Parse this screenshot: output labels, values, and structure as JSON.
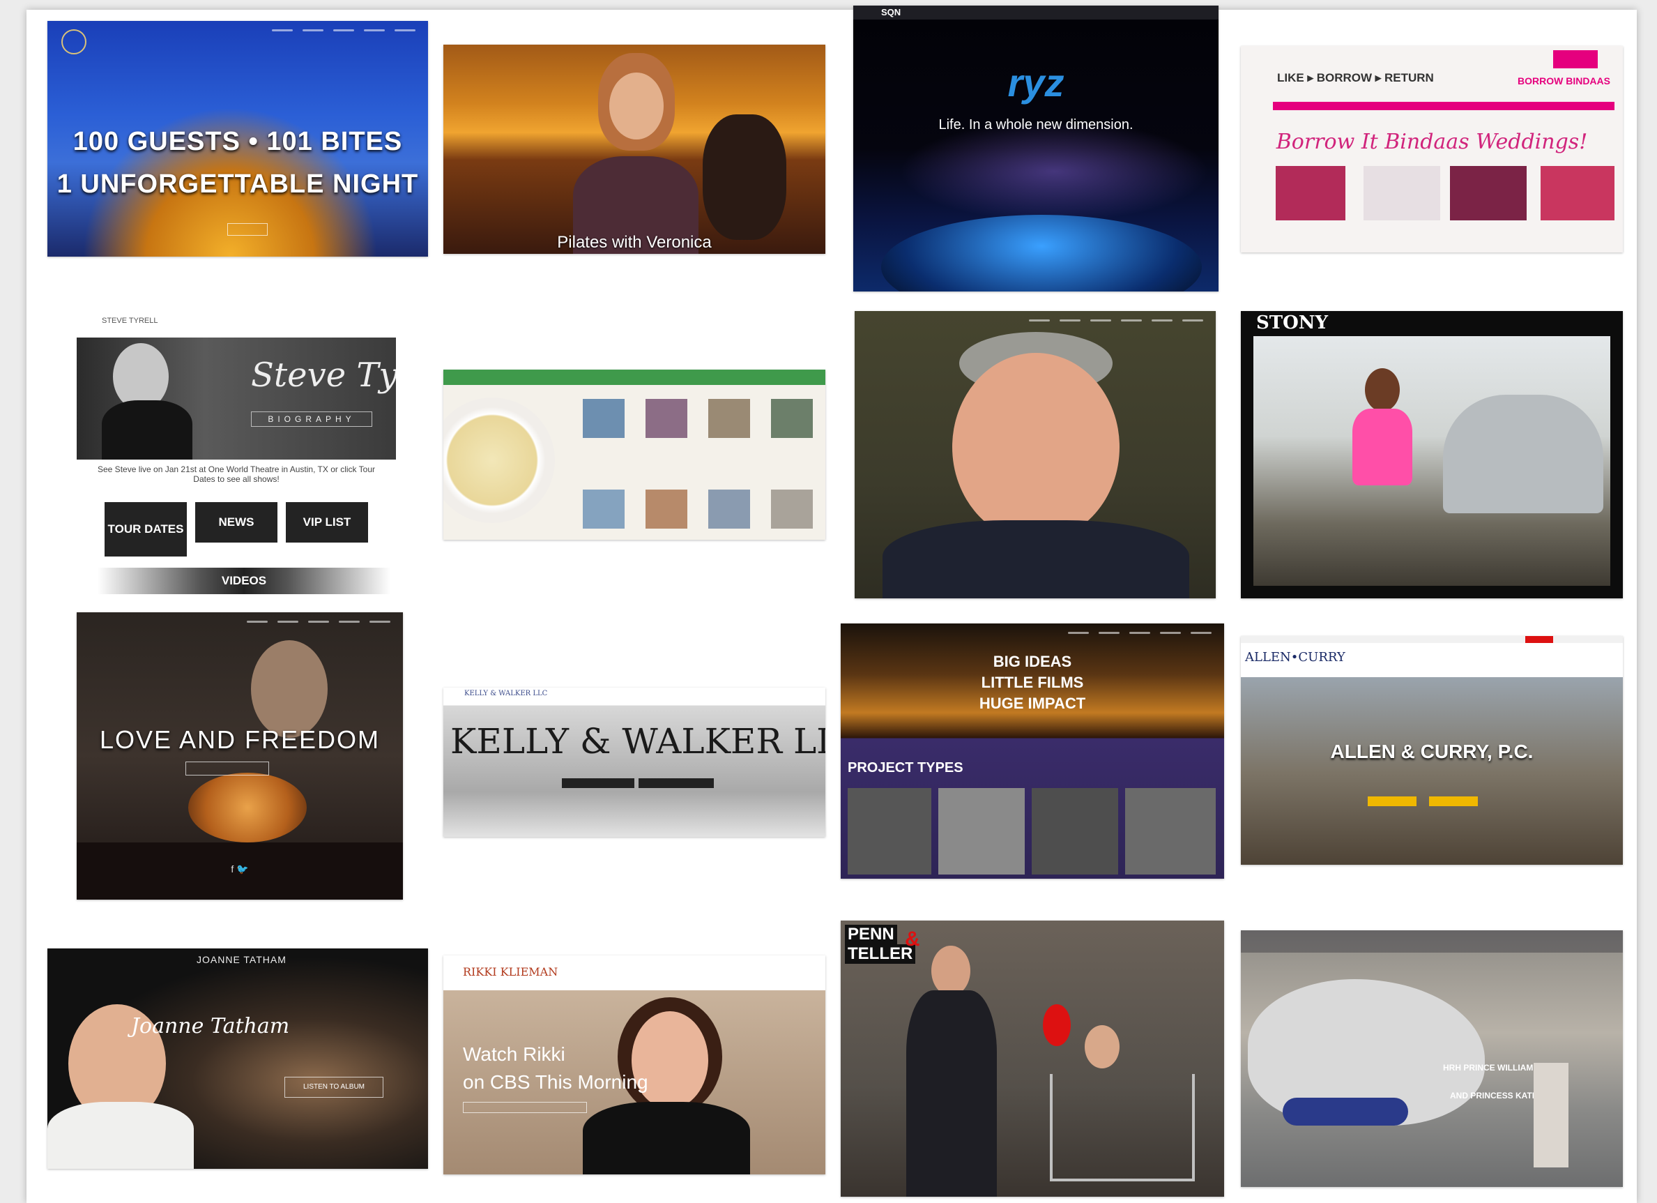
{
  "tiles": {
    "eiffel": {
      "line1": "100 GUESTS • 101 BITES",
      "line2": "1 UNFORGETTABLE NIGHT"
    },
    "pilates": {
      "caption": "Pilates with Veronica"
    },
    "ryz": {
      "logo": "ryz",
      "tagline": "Life. In a whole new dimension.",
      "top_logo": "SQN"
    },
    "borrow": {
      "nav": "LIKE ▸ BORROW ▸ RETURN",
      "brand": "BORROW BINDAAS",
      "script": "Borrow It Bindaas Weddings!"
    },
    "tyrell": {
      "name": "STEVE TYRELL",
      "signature": "Steve Tyrell",
      "section": "BIOGRAPHY",
      "note": "See Steve live on Jan 21st at One World Theatre in Austin, TX or click Tour Dates to see all shows!",
      "btn_tour": "TOUR DATES",
      "btn_news": "NEWS",
      "btn_vip": "VIP LIST",
      "btn_videos": "VIDEOS"
    },
    "love": {
      "title": "LOVE AND FREEDOM"
    },
    "kelly": {
      "logo_small": "KELLY & WALKER LLC",
      "title": "KELLY & WALKER LLC"
    },
    "films": {
      "line1": "BIG IDEAS",
      "line2": "LITTLE FILMS",
      "line3": "HUGE IMPACT",
      "section": "PROJECT TYPES"
    },
    "allen": {
      "logo": "ALLEN•CURRY",
      "title": "ALLEN & CURRY, P.C."
    },
    "stony": {
      "logo": "STONY"
    },
    "joanne": {
      "name": "JOANNE TATHAM",
      "script": "Joanne Tatham",
      "btn": "LISTEN TO ALBUM"
    },
    "rikki": {
      "name": "RIKKI KLIEMAN",
      "line1": "Watch Rikki",
      "line2": "on CBS This Morning"
    },
    "penn": {
      "logo1": "PENN",
      "logo2": "TELLER"
    },
    "heli": {
      "line1": "HRH PRINCE WILLIAM",
      "line2": "AND PRINCESS KATE"
    }
  },
  "colors": {
    "accent_pink": "#e5007e",
    "gold": "#f0b800",
    "ryz_blue": "#2b8fe0"
  }
}
